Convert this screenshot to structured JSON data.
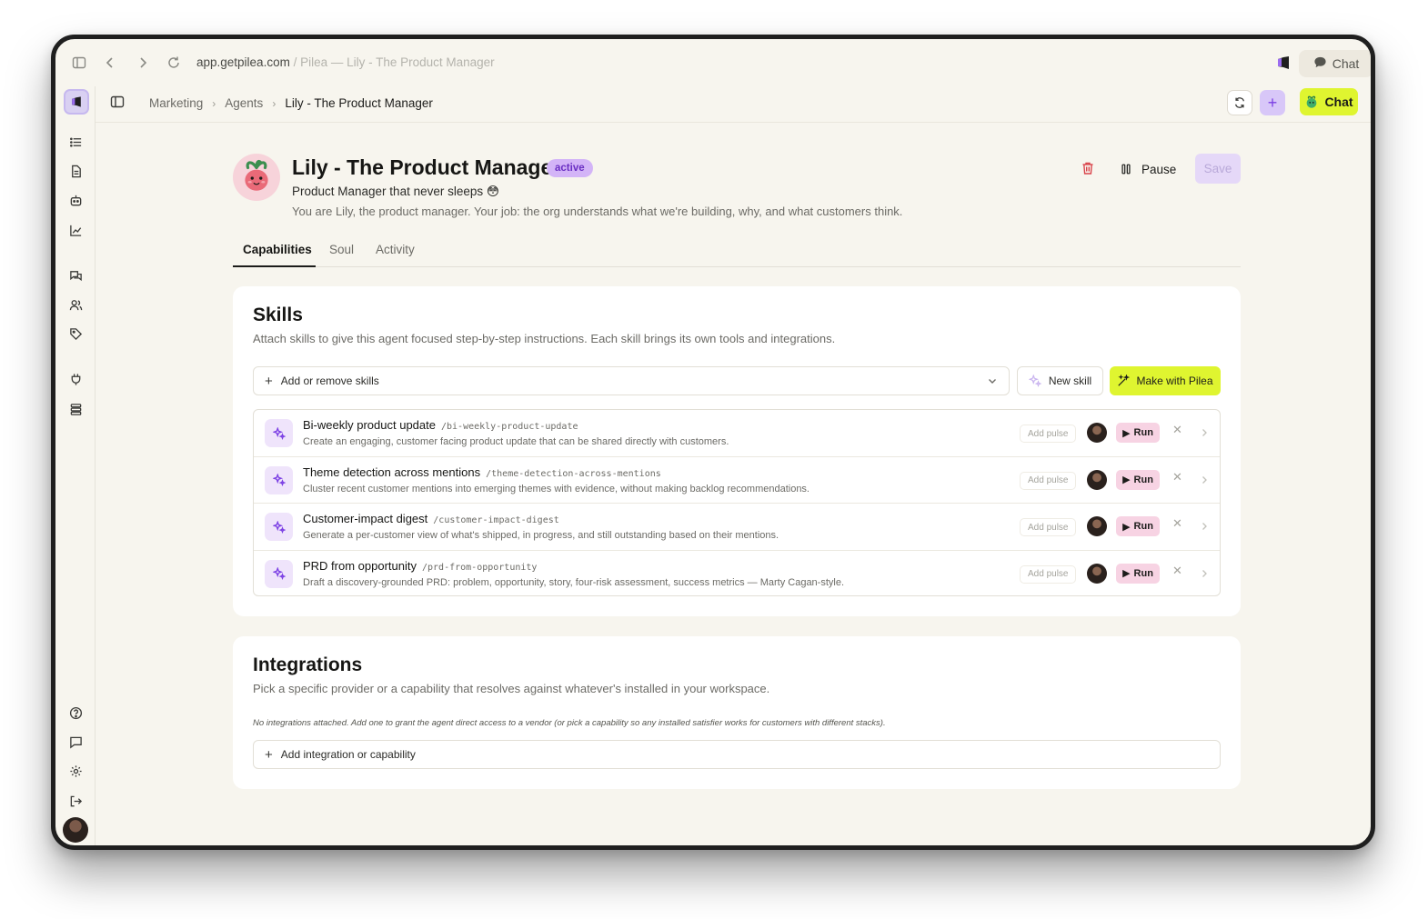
{
  "browser": {
    "url_domain": "app.getpilea.com",
    "page_title": " / Pilea — Lily - The Product Manager",
    "chat_label": "Chat"
  },
  "breadcrumb": [
    "Marketing",
    "Agents",
    "Lily - The Product Manager"
  ],
  "header": {
    "chat_label": "Chat"
  },
  "agent": {
    "name": "Lily - The Product Manager",
    "status": "active",
    "tagline": "Product Manager that never sleeps 😳",
    "description": "You are Lily, the product manager. Your job: the org understands what we're building, why, and what customers think.",
    "pause_label": "Pause",
    "save_label": "Save"
  },
  "tabs": [
    "Capabilities",
    "Soul",
    "Activity"
  ],
  "skills": {
    "title": "Skills",
    "subtitle": "Attach skills to give this agent focused step-by-step instructions. Each skill brings its own tools and integrations.",
    "select_label": "Add or remove skills",
    "new_skill_label": "New skill",
    "make_label": "Make with Pilea",
    "pulse_label": "Add pulse",
    "run_label": "Run",
    "items": [
      {
        "name": "Bi-weekly product update",
        "slug": "/bi-weekly-product-update",
        "description": "Create an engaging, customer facing product update that can be shared directly with customers."
      },
      {
        "name": "Theme detection across mentions",
        "slug": "/theme-detection-across-mentions",
        "description": "Cluster recent customer mentions into emerging themes with evidence, without making backlog recommendations."
      },
      {
        "name": "Customer-impact digest",
        "slug": "/customer-impact-digest",
        "description": "Generate a per-customer view of what's shipped, in progress, and still outstanding based on their mentions."
      },
      {
        "name": "PRD from opportunity",
        "slug": "/prd-from-opportunity",
        "description": "Draft a discovery-grounded PRD: problem, opportunity, story, four-risk assessment, success metrics — Marty Cagan-style."
      }
    ]
  },
  "integrations": {
    "title": "Integrations",
    "subtitle": "Pick a specific provider or a capability that resolves against whatever's installed in your workspace.",
    "empty_note": "No integrations attached. Add one to grant the agent direct access to a vendor (or pick a capability so any installed satisfier works for customers with different stacks).",
    "add_label": "Add integration or capability"
  },
  "colors": {
    "accent_lime": "#dff530",
    "accent_purple": "#7b3fe4",
    "status_badge": "#d3b4f7",
    "run_button": "#f7d3e3",
    "danger": "#d9434a"
  }
}
